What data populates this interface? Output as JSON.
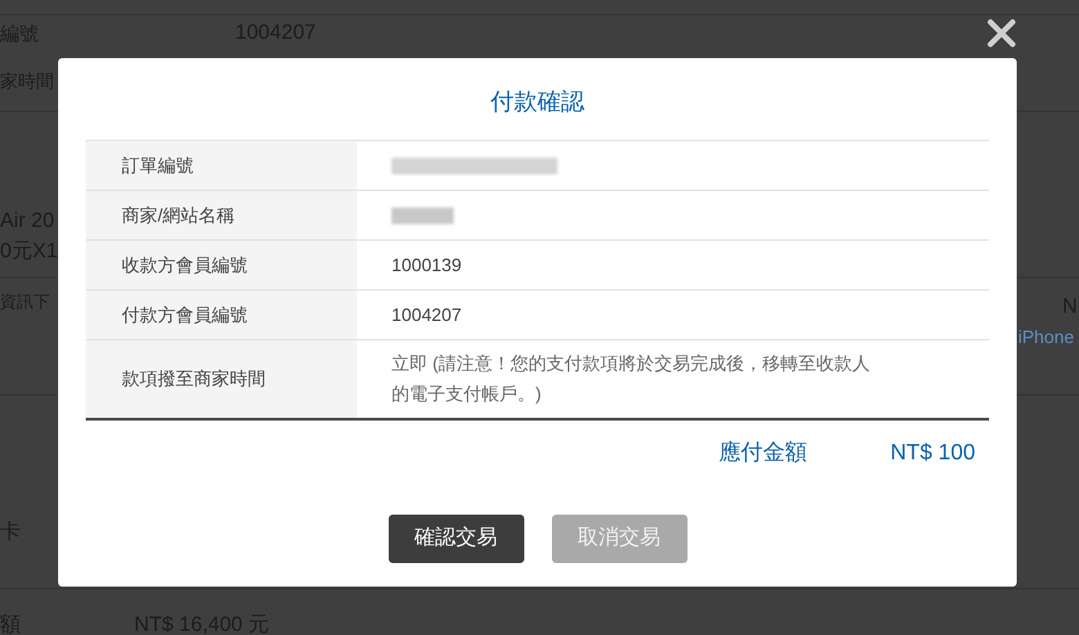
{
  "background_page": {
    "texts": [
      {
        "kind": "label",
        "text": "編號"
      },
      {
        "kind": "value",
        "text": "1004207"
      },
      {
        "kind": "label",
        "text": "家時間"
      },
      {
        "kind": "label",
        "text": "Air 20"
      },
      {
        "kind": "label",
        "text": "0元X1"
      },
      {
        "kind": "label",
        "text": "資訊下"
      },
      {
        "kind": "label",
        "text": "N"
      },
      {
        "kind": "link",
        "text": "iPhone"
      },
      {
        "kind": "label",
        "text": "卡"
      },
      {
        "kind": "label",
        "text": "額"
      },
      {
        "kind": "value",
        "text": "NT$ 16,400 元"
      }
    ]
  },
  "dialog": {
    "title": "付款確認",
    "rows": [
      {
        "label": "訂單編號",
        "redacted": true
      },
      {
        "label": "商家/網站名稱",
        "redacted": true
      },
      {
        "label": "收款方會員編號",
        "redacted": false,
        "value": "1000139"
      },
      {
        "label": "付款方會員編號",
        "redacted": false,
        "value": "1004207"
      },
      {
        "label": "款項撥至商家時間",
        "redacted": false,
        "value": "立即 (請注意！您的支付款項將於交易完成後，移轉至收款人的電子支付帳戶。)"
      }
    ],
    "total": {
      "label": "應付金額",
      "amount": "NT$ 100"
    },
    "buttons": [
      {
        "label": "確認交易",
        "kind": "primary"
      },
      {
        "label": "取消交易",
        "kind": "secondary"
      }
    ]
  }
}
